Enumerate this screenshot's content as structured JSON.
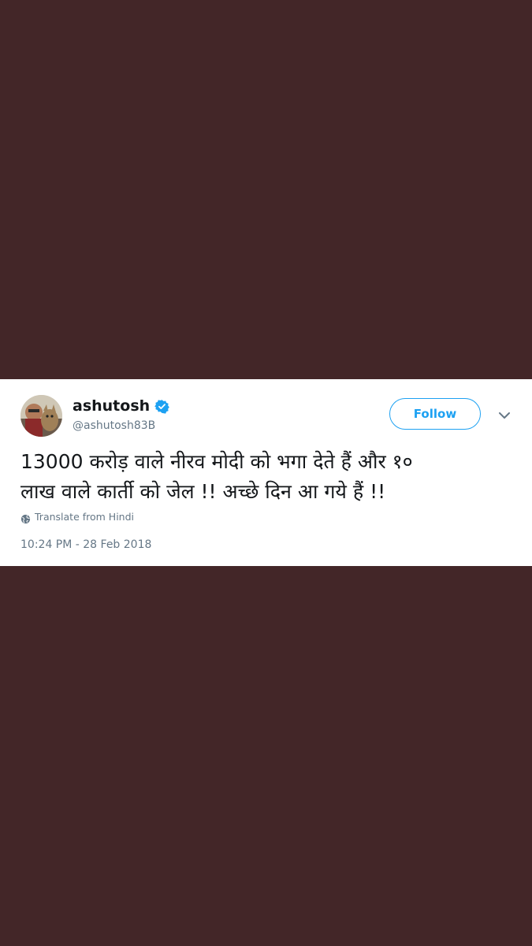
{
  "tweet": {
    "display_name": "ashutosh",
    "handle": "@ashutosh83B",
    "verified": true,
    "follow_label": "Follow",
    "text_line_1": "13000 करोड़ वाले नीरव मोदी को भगा देते हैं और १०",
    "text_line_2": "लाख वाले कार्ती को जेल !! अच्छे दिन आ गये हैं !!",
    "translate_label": "Translate from Hindi",
    "timestamp": "10:24 PM - 28 Feb 2018"
  },
  "icons": {
    "verified": "verified-badge-icon",
    "menu": "chevron-down-icon",
    "translate": "globe-icon"
  },
  "colors": {
    "background": "#432628",
    "card": "#ffffff",
    "accent": "#1da1f2",
    "primary_text": "#14171a",
    "secondary_text": "#657786"
  }
}
